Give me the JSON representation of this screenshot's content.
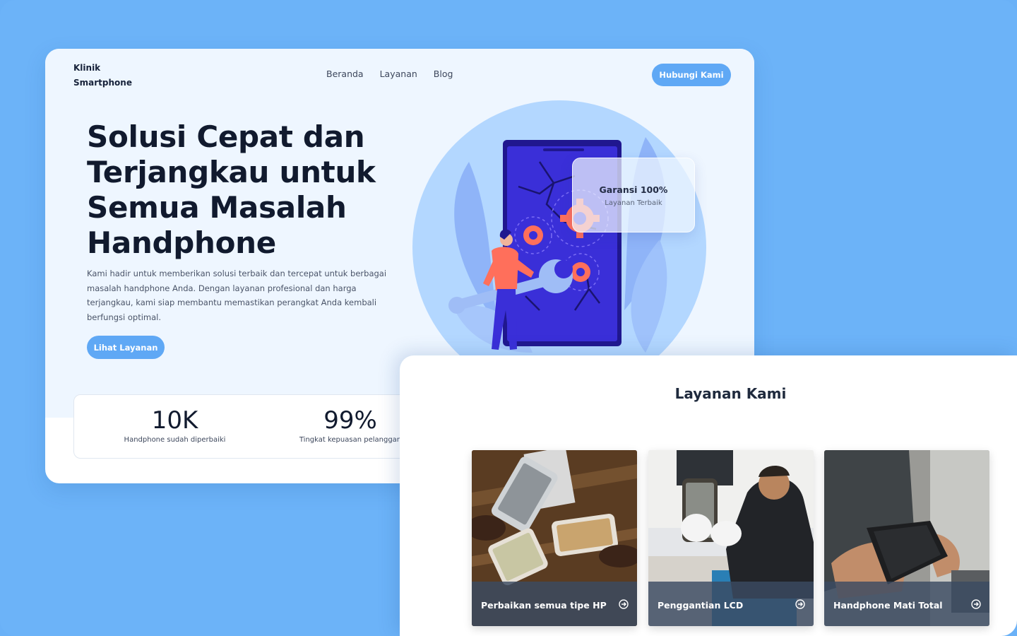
{
  "brand": {
    "line1": "Klinik",
    "line2": "Smartphone"
  },
  "nav": {
    "items": [
      "Beranda",
      "Layanan",
      "Blog"
    ]
  },
  "header": {
    "cta": "Hubungi Kami"
  },
  "hero": {
    "title_lines": [
      "Solusi Cepat dan",
      "Terjangkau untuk",
      "Semua Masalah",
      "Handphone"
    ],
    "description": "Kami hadir untuk memberikan solusi terbaik dan tercepat untuk berbagai masalah handphone Anda. Dengan layanan profesional dan harga terjangkau, kami siap membantu memastikan perangkat Anda kembali berfungsi optimal.",
    "cta": "Lihat Layanan"
  },
  "badge": {
    "title": "Garansi 100%",
    "subtitle": "Layanan Terbaik"
  },
  "stats": [
    {
      "value": "10K",
      "label": "Handphone sudah diperbaiki"
    },
    {
      "value": "99%",
      "label": "Tingkat kepuasan pelanggan"
    }
  ],
  "services": {
    "title": "Layanan Kami",
    "items": [
      {
        "label": "Perbaikan semua tipe HP",
        "icon": "arrow-right-circle-icon"
      },
      {
        "label": "Penggantian LCD",
        "icon": "arrow-right-circle-icon"
      },
      {
        "label": "Handphone Mati Total",
        "icon": "arrow-right-circle-icon"
      }
    ]
  },
  "colors": {
    "background": "#6cb3f8",
    "accent": "#5fa8f5",
    "hero_bg": "#eef6ff",
    "heading": "#111a2e",
    "illustration_phone": "#3a2fd8",
    "illustration_gear": "#ff6f5b"
  }
}
